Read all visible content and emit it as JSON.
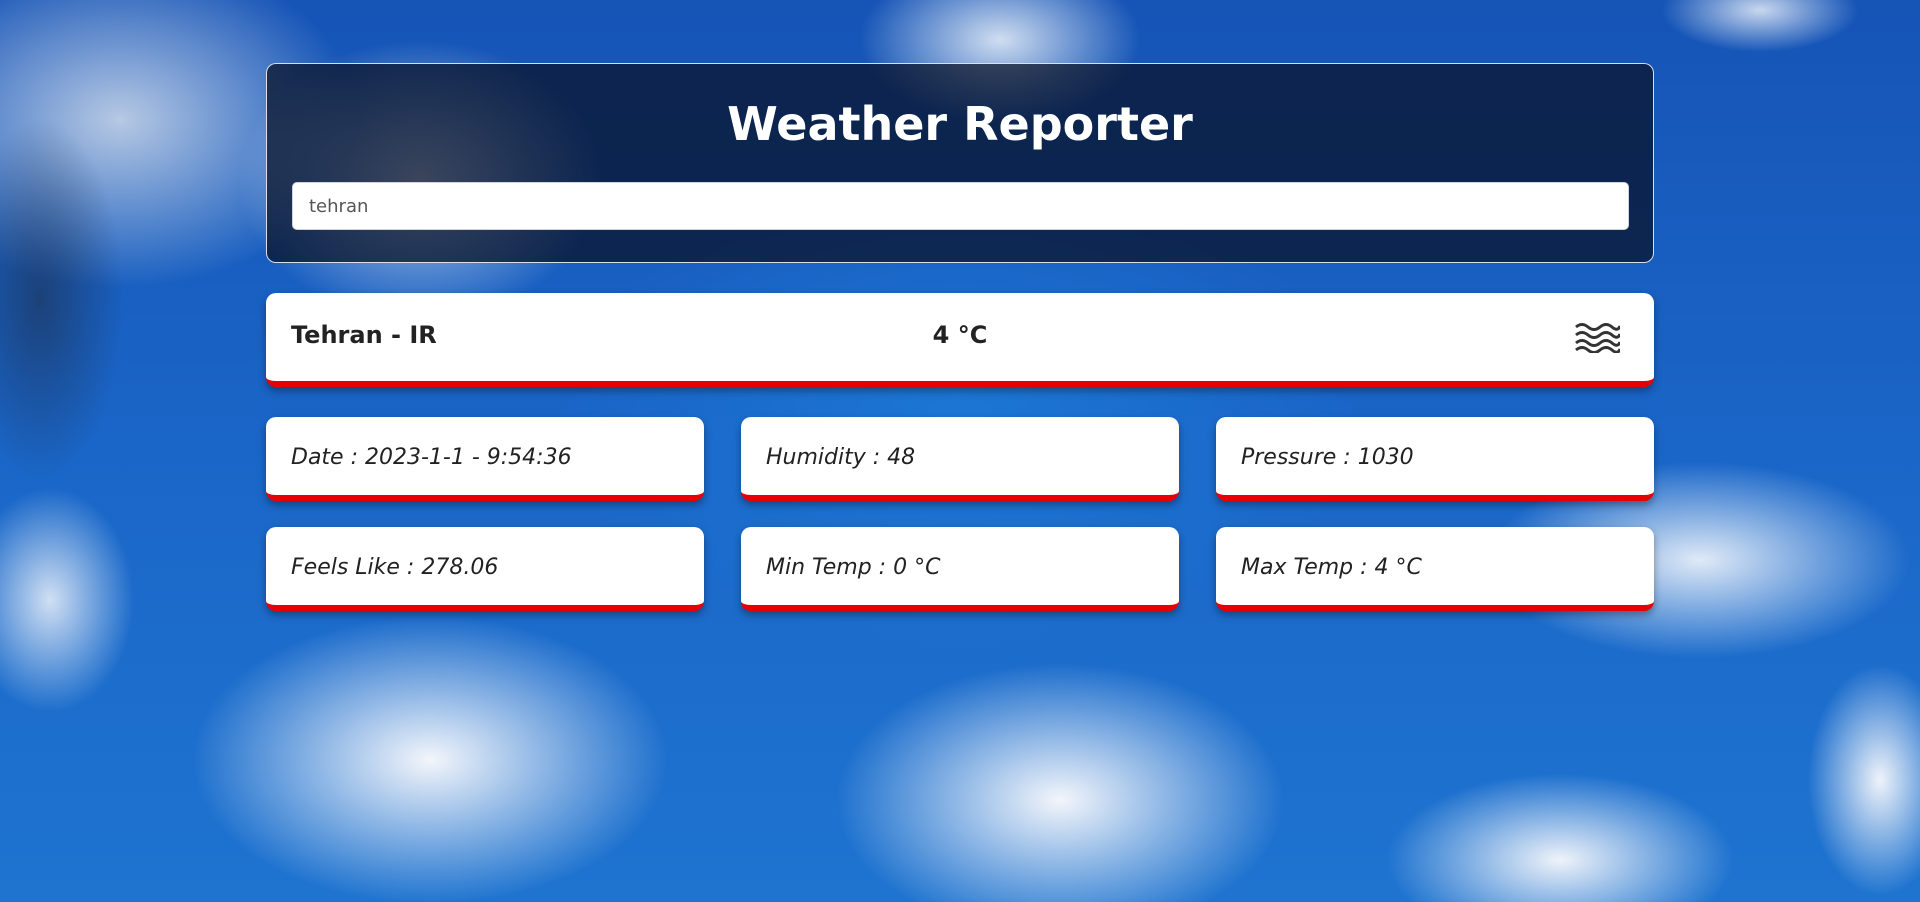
{
  "app": {
    "title": "Weather Reporter"
  },
  "search": {
    "value": "tehran"
  },
  "current": {
    "city_label": "Tehran - IR",
    "temperature": "4 °C",
    "icon": "mist-icon"
  },
  "details": [
    {
      "label": "Date : 2023-1-1 - 9:54:36"
    },
    {
      "label": "Humidity : 48"
    },
    {
      "label": "Pressure : 1030"
    },
    {
      "label": "Feels Like : 278.06"
    },
    {
      "label": "Min Temp : 0 °C"
    },
    {
      "label": "Max Temp : 4 °C"
    }
  ],
  "colors": {
    "accent": "#e60000",
    "header_panel": "#081026"
  }
}
